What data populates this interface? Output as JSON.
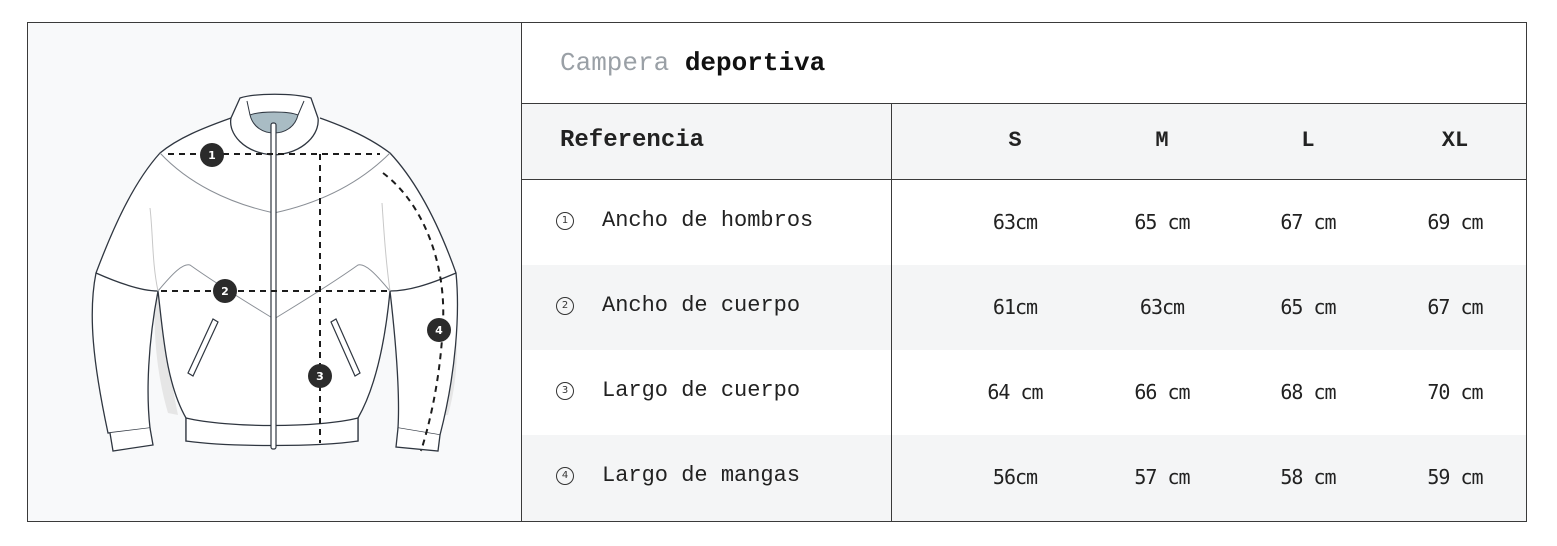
{
  "title": {
    "light": "Campera",
    "bold": "deportiva"
  },
  "table": {
    "reference_header": "Referencia",
    "sizes": [
      "S",
      "M",
      "L",
      "XL"
    ],
    "rows": [
      {
        "number": "1",
        "label": "Ancho de hombros",
        "values": [
          "63cm",
          "65 cm",
          "67 cm",
          "69 cm"
        ]
      },
      {
        "number": "2",
        "label": "Ancho de cuerpo",
        "values": [
          "61cm",
          "63cm",
          "65 cm",
          "67 cm"
        ]
      },
      {
        "number": "3",
        "label": "Largo de cuerpo",
        "values": [
          "64 cm",
          "66 cm",
          "68 cm",
          "70 cm"
        ]
      },
      {
        "number": "4",
        "label": "Largo de mangas",
        "values": [
          "56cm",
          "57 cm",
          "58 cm",
          "59 cm"
        ]
      }
    ]
  },
  "diagram": {
    "markers": [
      "1",
      "2",
      "3",
      "4"
    ],
    "colors": {
      "outline": "#2f3640",
      "collar_inner": "#a9bcc4",
      "shadow": "#e6e6e6",
      "marker_fill": "#2b2b2b"
    }
  }
}
